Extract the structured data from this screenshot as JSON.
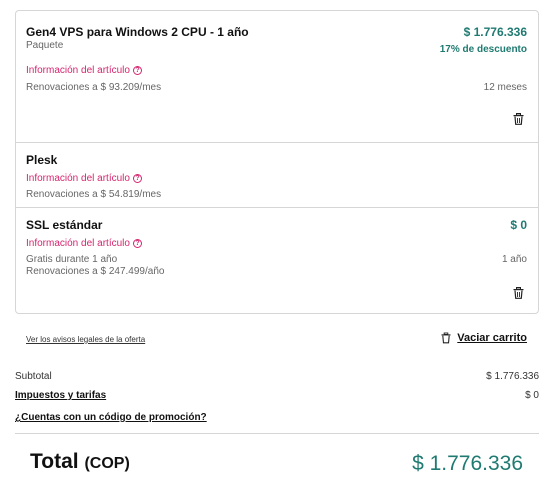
{
  "cart": {
    "items": [
      {
        "name": "Gen4 VPS para Windows 2 CPU - 1 año",
        "price": "$ 1.776.336",
        "subtitle": "Paquete",
        "discount": "17% de descuento",
        "info_label": "Información del artículo",
        "renewal": "Renovaciones a $ 93.209/mes",
        "term": "12 meses"
      },
      {
        "name": "Plesk",
        "info_label": "Información del artículo",
        "renewal": "Renovaciones a $ 54.819/mes"
      },
      {
        "name": "SSL estándar",
        "price": "$ 0",
        "info_label": "Información del artículo",
        "free_line": "Gratis durante 1 año",
        "renewal": "Renovaciones a $ 247.499/año",
        "term": "1 año"
      }
    ]
  },
  "footer": {
    "legal_link": "Ver los avisos legales de la oferta",
    "empty_cart": "Vaciar carrito"
  },
  "summary": {
    "subtotal_label": "Subtotal",
    "subtotal_value": "$ 1.776.336",
    "taxes_label": "Impuestos y tarifas",
    "taxes_value": "$ 0",
    "promo_link": "¿Cuentas con un código de promoción?"
  },
  "total": {
    "label": "Total",
    "currency": "(COP)",
    "value": "$ 1.776.336"
  },
  "colors": {
    "price": "#1f7a71",
    "info_link": "#d6246e",
    "border": "#d6d6d6"
  }
}
